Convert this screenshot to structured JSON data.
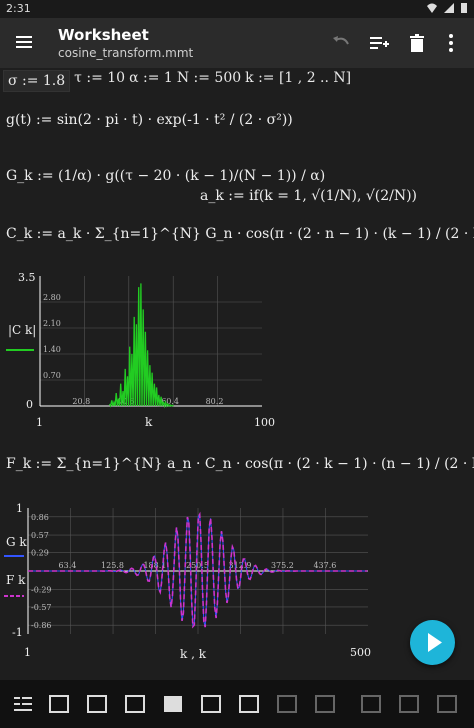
{
  "status": {
    "time": "2:31"
  },
  "appbar": {
    "title": "Worksheet",
    "subtitle": "cosine_transform.mmt"
  },
  "defs": [
    "σ := 1.8",
    "τ := 10",
    "α := 1",
    "N := 500",
    "k := [1 , 2 .. N]"
  ],
  "expressions": {
    "g": "g(t) := sin(2 · pi · t) · exp(-1 · t² / (2 · σ²))",
    "G": "G_k := (1/α) · g((τ − 20 · (k − 1)/(N − 1)) / α)",
    "a": "a_k := if(k = 1, √(1/N), √(2/N))",
    "C": "C_k := a_k · Σ_{n=1}^{N} G_n · cos(π · (2 · n − 1) · (k − 1) / (2 · N))",
    "F": "F_k := Σ_{n=1}^{N} a_n · C_n · cos(π · (2 · k − 1) · (n − 1) / (2 · N))"
  },
  "chart_data": [
    {
      "type": "line",
      "ylabel": "|C k|",
      "xlabel": "k",
      "xlim": [
        1,
        100
      ],
      "ylim": [
        0,
        3.5
      ],
      "x_ticks": [
        "20.8",
        "40.6",
        "60.4",
        "80.2"
      ],
      "y_ticks": [
        "2.80",
        "2.10",
        "1.40",
        "0.70"
      ],
      "x_range_labels": [
        "1",
        "100"
      ],
      "y_range_labels": [
        "0",
        "3.5"
      ],
      "series": [
        {
          "name": "|C k|",
          "color": "#22cc22",
          "x": [
            32,
            33,
            34,
            35,
            36,
            37,
            38,
            39,
            40,
            41,
            42,
            43,
            44,
            45,
            46,
            47,
            48,
            49,
            50,
            51,
            52,
            53,
            54,
            55,
            56,
            57,
            58,
            59,
            60
          ],
          "values": [
            0.05,
            0.15,
            0.1,
            0.35,
            0.2,
            0.6,
            0.4,
            1.0,
            0.8,
            1.6,
            1.4,
            2.4,
            2.2,
            3.2,
            3.3,
            2.6,
            2.0,
            1.5,
            1.1,
            0.9,
            0.6,
            0.5,
            0.3,
            0.25,
            0.12,
            0.1,
            0.05,
            0.03,
            0.02
          ]
        }
      ]
    },
    {
      "type": "line",
      "xlabel": "k , k",
      "xlim": [
        1,
        500
      ],
      "ylim": [
        -1,
        1
      ],
      "x_ticks": [
        "63.4",
        "125.8",
        "188.1",
        "250.5",
        "312.9",
        "375.2",
        "437.6"
      ],
      "y_ticks": [
        "0.86",
        "0.57",
        "0.29",
        "-0.29",
        "-0.57",
        "-0.86"
      ],
      "x_range_labels": [
        "1",
        "500"
      ],
      "y_range_labels": [
        "1",
        "-1"
      ],
      "series": [
        {
          "name": "G k",
          "color": "#3355ff"
        },
        {
          "name": "F k",
          "color": "#cc33cc"
        }
      ]
    }
  ]
}
